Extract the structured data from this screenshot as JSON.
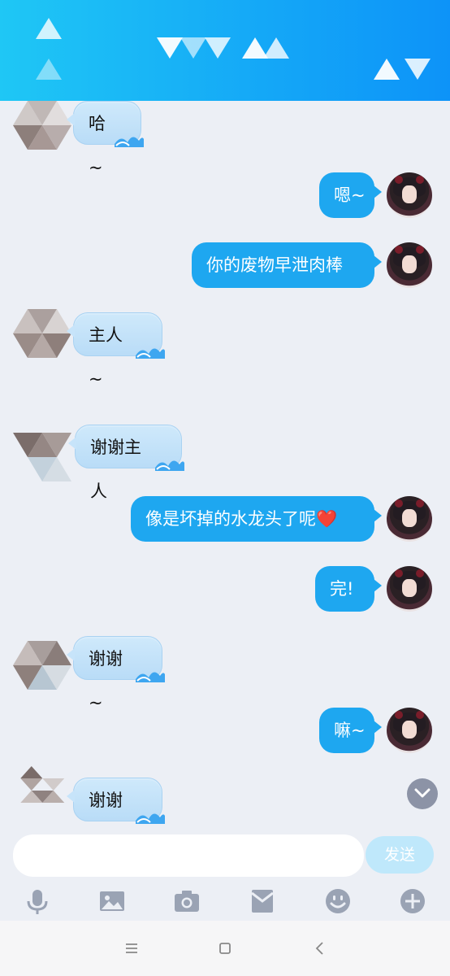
{
  "chat": {
    "messages": [
      {
        "side": "left",
        "text": "哈 ~"
      },
      {
        "side": "right",
        "text": "嗯~"
      },
      {
        "side": "right",
        "text": "你的废物早泄肉棒"
      },
      {
        "side": "left",
        "text": "主人 ~"
      },
      {
        "side": "left",
        "text": "谢谢主人"
      },
      {
        "side": "right",
        "text": "像是坏掉的水龙头了呢❤️"
      },
      {
        "side": "right",
        "text": "完!"
      },
      {
        "side": "left",
        "text": "谢谢 ~"
      },
      {
        "side": "right",
        "text": "嘛~"
      },
      {
        "side": "left",
        "text": "谢谢 ~"
      }
    ]
  },
  "input": {
    "send_label": "发送",
    "placeholder": ""
  },
  "toolbar": {
    "icons": [
      "microphone-icon",
      "image-icon",
      "camera-icon",
      "red-packet-icon",
      "emoji-icon",
      "plus-icon"
    ]
  },
  "navbar": {
    "icons": [
      "menu-icon",
      "home-icon",
      "back-icon"
    ]
  },
  "colors": {
    "header": "#14a7f7",
    "bubble_right": "#1ea7f0",
    "bubble_left": "#c7e4fa",
    "background": "#eceff5"
  }
}
